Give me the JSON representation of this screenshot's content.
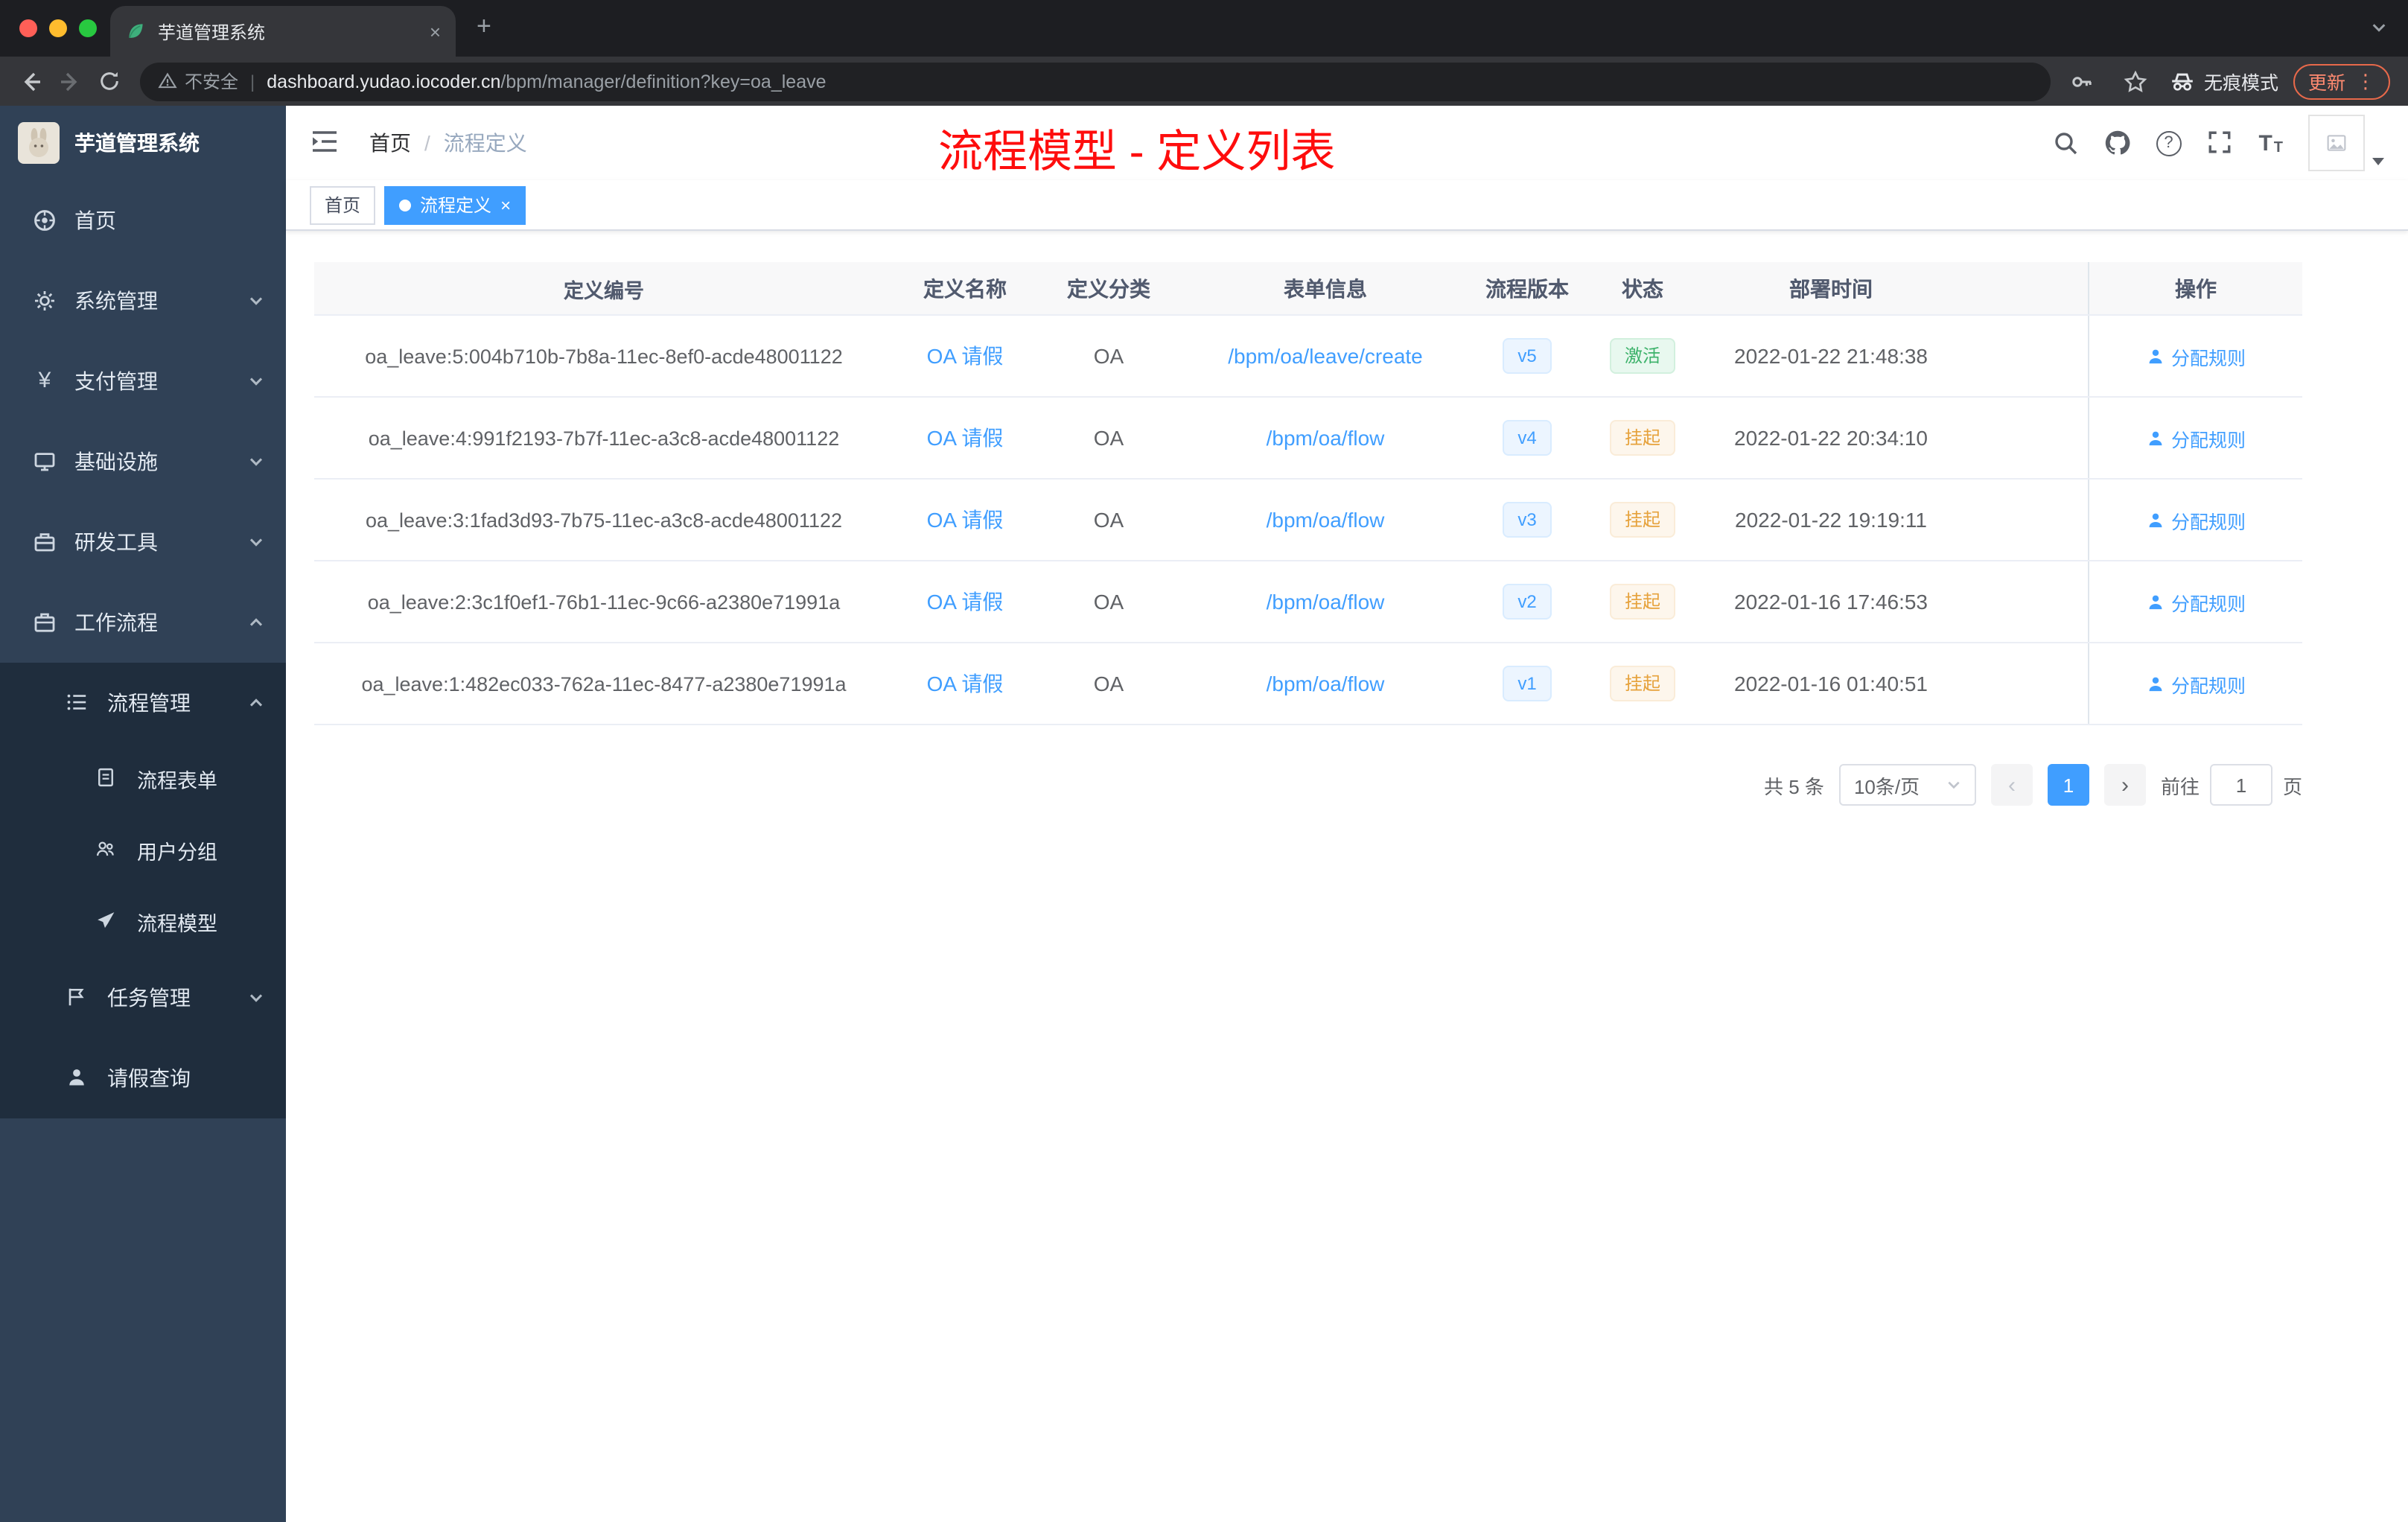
{
  "colors": {
    "accent": "#409eff",
    "success_text": "#3cb26a",
    "warning_text": "#e6a23c",
    "overlay_red": "#fe0d0d",
    "sidebar_bg": "#304156",
    "submenu_bg": "#1f2d3d"
  },
  "browser": {
    "tab": {
      "title": "芋道管理系统"
    },
    "address": {
      "security_label": "不安全",
      "host": "dashboard.yudao.iocoder.cn",
      "path": "/bpm/manager/definition?key=oa_leave"
    },
    "incognito_label": "无痕模式",
    "update_label": "更新"
  },
  "sidebar": {
    "logo_title": "芋道管理系统",
    "items": [
      {
        "label": "首页"
      },
      {
        "label": "系统管理"
      },
      {
        "label": "支付管理"
      },
      {
        "label": "基础设施"
      },
      {
        "label": "研发工具"
      },
      {
        "label": "工作流程"
      }
    ],
    "submenu": {
      "process_mgmt_label": "流程管理",
      "process_children": [
        {
          "label": "流程表单"
        },
        {
          "label": "用户分组"
        },
        {
          "label": "流程模型"
        }
      ],
      "task_mgmt_label": "任务管理",
      "leave_query_label": "请假查询"
    }
  },
  "header": {
    "breadcrumb": [
      {
        "label": "首页"
      },
      {
        "label": "流程定义"
      }
    ],
    "breadcrumb_separator": "/",
    "overlay_title": "流程模型 - 定义列表"
  },
  "tags": [
    {
      "label": "首页"
    },
    {
      "label": "流程定义"
    }
  ],
  "table": {
    "columns": [
      "定义编号",
      "定义名称",
      "定义分类",
      "表单信息",
      "流程版本",
      "状态",
      "部署时间",
      "操作"
    ],
    "action_label": "分配规则",
    "rows": [
      {
        "id": "oa_leave:5:004b710b-7b8a-11ec-8ef0-acde48001122",
        "name": "OA 请假",
        "category": "OA",
        "form": "/bpm/oa/leave/create",
        "version": "v5",
        "status": "激活",
        "time": "2022-01-22 21:48:38"
      },
      {
        "id": "oa_leave:4:991f2193-7b7f-11ec-a3c8-acde48001122",
        "name": "OA 请假",
        "category": "OA",
        "form": "/bpm/oa/flow",
        "version": "v4",
        "status": "挂起",
        "time": "2022-01-22 20:34:10"
      },
      {
        "id": "oa_leave:3:1fad3d93-7b75-11ec-a3c8-acde48001122",
        "name": "OA 请假",
        "category": "OA",
        "form": "/bpm/oa/flow",
        "version": "v3",
        "status": "挂起",
        "time": "2022-01-22 19:19:11"
      },
      {
        "id": "oa_leave:2:3c1f0ef1-76b1-11ec-9c66-a2380e71991a",
        "name": "OA 请假",
        "category": "OA",
        "form": "/bpm/oa/flow",
        "version": "v2",
        "status": "挂起",
        "time": "2022-01-16 17:46:53"
      },
      {
        "id": "oa_leave:1:482ec033-762a-11ec-8477-a2380e71991a",
        "name": "OA 请假",
        "category": "OA",
        "form": "/bpm/oa/flow",
        "version": "v1",
        "status": "挂起",
        "time": "2022-01-16 01:40:51"
      }
    ]
  },
  "pagination": {
    "total": "共 5 条",
    "page_size": "10条/页",
    "current_page": "1",
    "goto_label": "前往",
    "goto_value": "1",
    "goto_unit": "页"
  }
}
